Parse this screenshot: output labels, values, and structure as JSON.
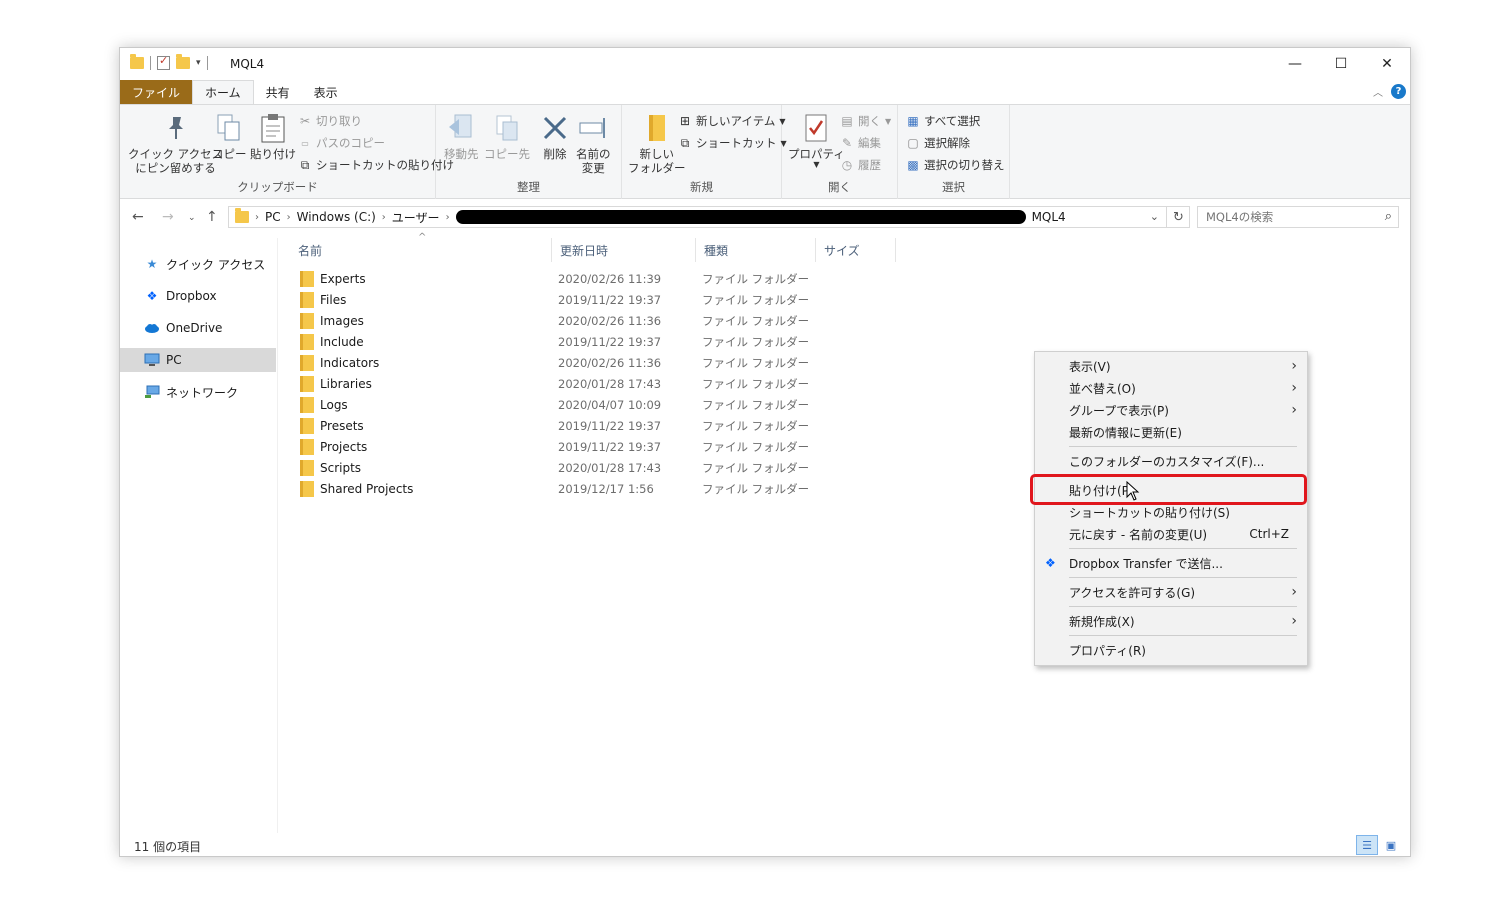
{
  "window": {
    "title": "MQL4",
    "controls": {
      "minimize": "—",
      "maximize": "☐",
      "close": "✕"
    }
  },
  "tabs": {
    "file": "ファイル",
    "home": "ホーム",
    "share": "共有",
    "view": "表示"
  },
  "ribbon": {
    "clipboard": {
      "label": "クリップボード",
      "pin_line1": "クイック アクセス",
      "pin_line2": "にピン留めする",
      "copy": "コピー",
      "paste": "貼り付け",
      "cut": "切り取り",
      "copy_path": "パスのコピー",
      "paste_shortcut": "ショートカットの貼り付け"
    },
    "organize": {
      "label": "整理",
      "move_to": "移動先",
      "copy_to": "コピー先",
      "delete": "削除",
      "rename_line1": "名前の",
      "rename_line2": "変更"
    },
    "new": {
      "label": "新規",
      "new_folder_line1": "新しい",
      "new_folder_line2": "フォルダー",
      "new_item": "新しいアイテム",
      "shortcut": "ショートカット"
    },
    "open": {
      "label": "開く",
      "properties": "プロパティ",
      "open": "開く",
      "edit": "編集",
      "history": "履歴"
    },
    "select": {
      "label": "選択",
      "select_all": "すべて選択",
      "select_none": "選択解除",
      "invert": "選択の切り替え"
    }
  },
  "address": {
    "crumbs": [
      "PC",
      "Windows (C:)",
      "ユーザー",
      "MQL4"
    ],
    "search_placeholder": "MQL4の検索"
  },
  "nav": {
    "items": [
      {
        "label": "クイック アクセス",
        "icon": "star-icon"
      },
      {
        "label": "Dropbox",
        "icon": "dropbox-icon"
      },
      {
        "label": "OneDrive",
        "icon": "cloud-icon"
      },
      {
        "label": "PC",
        "icon": "monitor-icon"
      },
      {
        "label": "ネットワーク",
        "icon": "network-icon"
      }
    ]
  },
  "columns": {
    "name": "名前",
    "date": "更新日時",
    "type": "種類",
    "size": "サイズ"
  },
  "files": [
    {
      "name": "Experts",
      "date": "2020/02/26 11:39",
      "type": "ファイル フォルダー"
    },
    {
      "name": "Files",
      "date": "2019/11/22 19:37",
      "type": "ファイル フォルダー"
    },
    {
      "name": "Images",
      "date": "2020/02/26 11:36",
      "type": "ファイル フォルダー"
    },
    {
      "name": "Include",
      "date": "2019/11/22 19:37",
      "type": "ファイル フォルダー"
    },
    {
      "name": "Indicators",
      "date": "2020/02/26 11:36",
      "type": "ファイル フォルダー"
    },
    {
      "name": "Libraries",
      "date": "2020/01/28 17:43",
      "type": "ファイル フォルダー"
    },
    {
      "name": "Logs",
      "date": "2020/04/07 10:09",
      "type": "ファイル フォルダー"
    },
    {
      "name": "Presets",
      "date": "2019/11/22 19:37",
      "type": "ファイル フォルダー"
    },
    {
      "name": "Projects",
      "date": "2019/11/22 19:37",
      "type": "ファイル フォルダー"
    },
    {
      "name": "Scripts",
      "date": "2020/01/28 17:43",
      "type": "ファイル フォルダー"
    },
    {
      "name": "Shared Projects",
      "date": "2019/12/17 1:56",
      "type": "ファイル フォルダー"
    }
  ],
  "status": {
    "count": "11 個の項目"
  },
  "context_menu": {
    "view": "表示(V)",
    "sort": "並べ替え(O)",
    "group": "グループで表示(P)",
    "refresh": "最新の情報に更新(E)",
    "customize": "このフォルダーのカスタマイズ(F)...",
    "paste": "貼り付け(P",
    "paste_shortcut": "ショートカットの貼り付け(S)",
    "undo": "元に戻す - 名前の変更(U)",
    "undo_shortcut": "Ctrl+Z",
    "dropbox": "Dropbox Transfer で送信...",
    "give_access": "アクセスを許可する(G)",
    "new": "新規作成(X)",
    "properties": "プロパティ(R)"
  },
  "colors": {
    "file_tab": "#9a6b19",
    "highlight": "#e0161d",
    "folder": "#f5c74a"
  }
}
